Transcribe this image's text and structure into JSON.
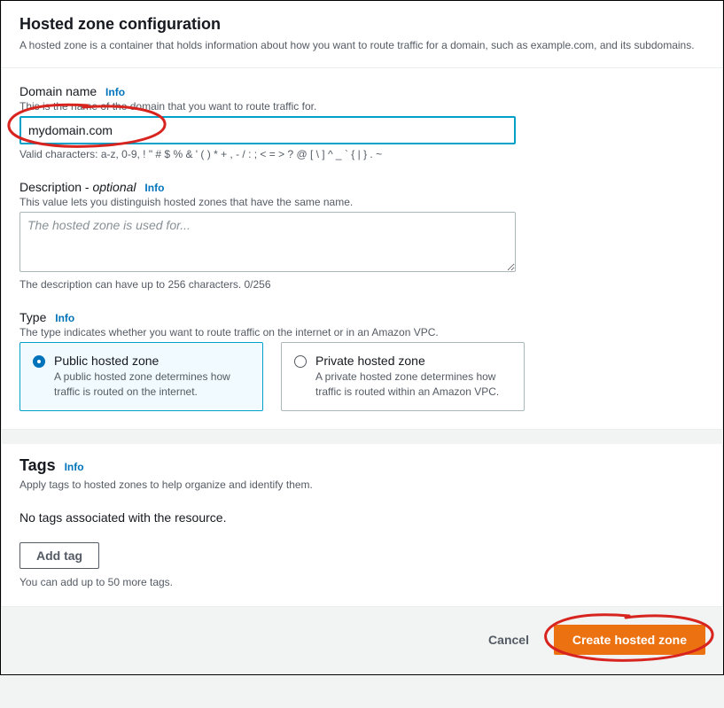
{
  "config": {
    "title": "Hosted zone configuration",
    "subtitle": "A hosted zone is a container that holds information about how you want to route traffic for a domain, such as example.com, and its subdomains.",
    "domain": {
      "label": "Domain name",
      "info": "Info",
      "desc": "This is the name of the domain that you want to route traffic for.",
      "value": "mydomain.com",
      "hint": "Valid characters: a-z, 0-9, ! \" # $ % & ' ( ) * + , - / : ; < = > ? @ [ \\ ] ^ _ ` { | } . ~"
    },
    "description": {
      "label": "Description - ",
      "optional": "optional",
      "info": "Info",
      "desc": "This value lets you distinguish hosted zones that have the same name.",
      "placeholder": "The hosted zone is used for...",
      "value": "",
      "hint": "The description can have up to 256 characters. 0/256"
    },
    "type": {
      "label": "Type",
      "info": "Info",
      "desc": "The type indicates whether you want to route traffic on the internet or in an Amazon VPC.",
      "public": {
        "title": "Public hosted zone",
        "desc": "A public hosted zone determines how traffic is routed on the internet."
      },
      "private": {
        "title": "Private hosted zone",
        "desc": "A private hosted zone determines how traffic is routed within an Amazon VPC."
      },
      "selected": "public"
    }
  },
  "tags": {
    "title": "Tags",
    "info": "Info",
    "desc": "Apply tags to hosted zones to help organize and identify them.",
    "empty": "No tags associated with the resource.",
    "addButton": "Add tag",
    "hint": "You can add up to 50 more tags."
  },
  "footer": {
    "cancel": "Cancel",
    "create": "Create hosted zone"
  }
}
